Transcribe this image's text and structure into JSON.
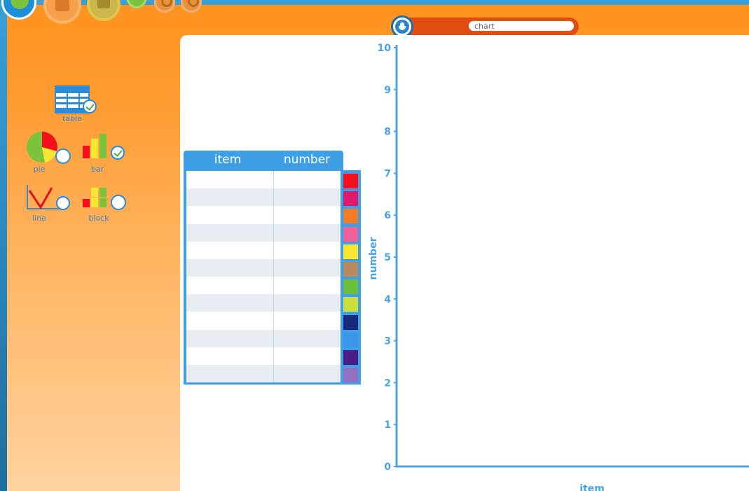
{
  "title_bar": {
    "chart_title_value": "chart"
  },
  "sidebar": {
    "tools": [
      {
        "id": "table",
        "label": "table",
        "selected": true
      },
      {
        "id": "pie",
        "label": "pie",
        "selected": false
      },
      {
        "id": "bar",
        "label": "bar",
        "selected": true
      },
      {
        "id": "line",
        "label": "line",
        "selected": false
      },
      {
        "id": "block",
        "label": "block",
        "selected": false
      }
    ]
  },
  "table": {
    "headers": [
      "item",
      "number"
    ],
    "rows": [
      {
        "item": "",
        "number": ""
      },
      {
        "item": "",
        "number": ""
      },
      {
        "item": "",
        "number": ""
      },
      {
        "item": "",
        "number": ""
      },
      {
        "item": "",
        "number": ""
      },
      {
        "item": "",
        "number": ""
      },
      {
        "item": "",
        "number": ""
      },
      {
        "item": "",
        "number": ""
      },
      {
        "item": "",
        "number": ""
      },
      {
        "item": "",
        "number": ""
      },
      {
        "item": "",
        "number": ""
      },
      {
        "item": "",
        "number": ""
      }
    ],
    "row_colors": [
      "#f5101e",
      "#e01a6a",
      "#f57c27",
      "#f0609a",
      "#f7e733",
      "#b98a5c",
      "#6cbf3a",
      "#cadf3a",
      "#1a2a7a",
      "#3a96e8",
      "#4a1e86",
      "#9370c0"
    ]
  },
  "chart_data": {
    "type": "bar",
    "categories": [],
    "values": [],
    "xlabel": "item",
    "ylabel": "number",
    "ylim": [
      0,
      10
    ],
    "y_ticks": [
      "0",
      "1",
      "2",
      "3",
      "4",
      "5",
      "6",
      "7",
      "8",
      "9",
      "10"
    ],
    "axis_color": "#4aa3e6"
  },
  "colors": {
    "accent_orange": "#ff931f",
    "accent_blue": "#3f9fe6"
  }
}
